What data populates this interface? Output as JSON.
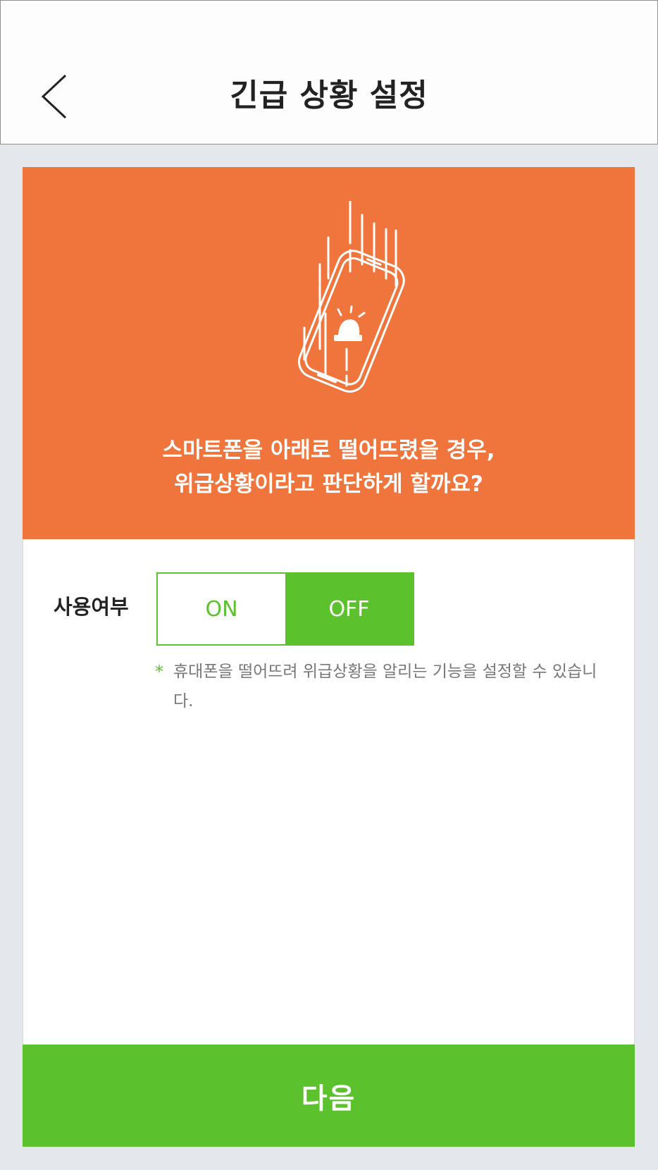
{
  "header": {
    "title": "긴급 상황 설정",
    "back_icon": "chevron-left-icon"
  },
  "hero": {
    "illustration_icon": "falling-phone-siren-icon",
    "message_line1": "스마트폰을 아래로 떨어뜨렸을 경우,",
    "message_line2": "위급상황이라고 판단하게 할까요?",
    "background_color": "#f0753c"
  },
  "usage": {
    "label": "사용여부",
    "on_label": "ON",
    "off_label": "OFF",
    "selected": "OFF"
  },
  "note": {
    "marker": "*",
    "text": "휴대폰을 떨어뜨려 위급상황을 알리는 기능을 설정할 수 있습니다."
  },
  "footer": {
    "next_label": "다음"
  },
  "colors": {
    "accent_green": "#5bc22e",
    "accent_orange": "#f0753c"
  }
}
